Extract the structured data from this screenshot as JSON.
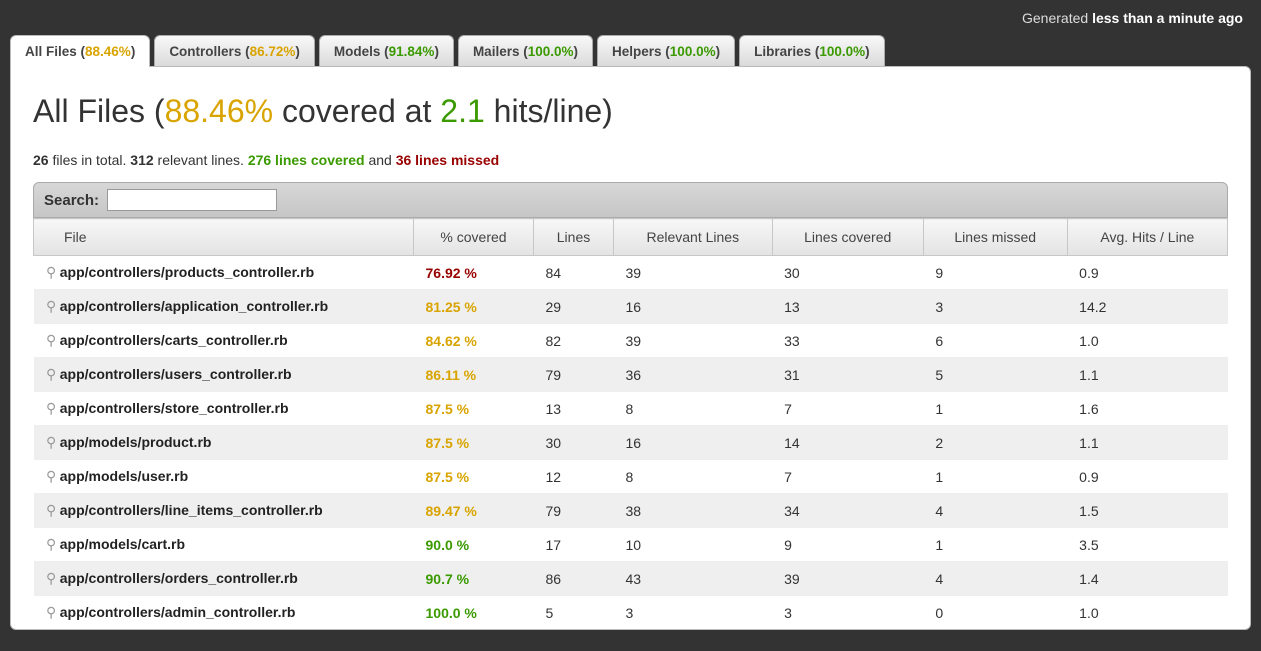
{
  "generated": {
    "prefix": "Generated",
    "time": "less than a minute ago"
  },
  "tabs": [
    {
      "label": "All Files",
      "pct": "88.46%",
      "color": "yellow",
      "active": true
    },
    {
      "label": "Controllers",
      "pct": "86.72%",
      "color": "yellow",
      "active": false
    },
    {
      "label": "Models",
      "pct": "91.84%",
      "color": "green",
      "active": false
    },
    {
      "label": "Mailers",
      "pct": "100.0%",
      "color": "green",
      "active": false
    },
    {
      "label": "Helpers",
      "pct": "100.0%",
      "color": "green",
      "active": false
    },
    {
      "label": "Libraries",
      "pct": "100.0%",
      "color": "green",
      "active": false
    }
  ],
  "title": {
    "prefix": "All Files (",
    "pct": "88.46%",
    "mid": " covered at ",
    "hits": "2.1",
    "suffix": " hits/line)"
  },
  "summary": {
    "total_files": "26",
    "files_text": " files in total. ",
    "relevant": "312",
    "relevant_text": " relevant lines. ",
    "covered": "276 lines covered",
    "and": " and ",
    "missed": "36 lines missed"
  },
  "search": {
    "label": "Search:",
    "value": ""
  },
  "columns": {
    "file": "File",
    "pct": "% covered",
    "lines": "Lines",
    "relevant": "Relevant Lines",
    "covered": "Lines covered",
    "missed": "Lines missed",
    "avg": "Avg. Hits / Line"
  },
  "rows": [
    {
      "file": "app/controllers/products_controller.rb",
      "pct": "76.92 %",
      "pctColor": "red",
      "lines": "84",
      "relevant": "39",
      "covered": "30",
      "missed": "9",
      "avg": "0.9"
    },
    {
      "file": "app/controllers/application_controller.rb",
      "pct": "81.25 %",
      "pctColor": "yellow",
      "lines": "29",
      "relevant": "16",
      "covered": "13",
      "missed": "3",
      "avg": "14.2"
    },
    {
      "file": "app/controllers/carts_controller.rb",
      "pct": "84.62 %",
      "pctColor": "yellow",
      "lines": "82",
      "relevant": "39",
      "covered": "33",
      "missed": "6",
      "avg": "1.0"
    },
    {
      "file": "app/controllers/users_controller.rb",
      "pct": "86.11 %",
      "pctColor": "yellow",
      "lines": "79",
      "relevant": "36",
      "covered": "31",
      "missed": "5",
      "avg": "1.1"
    },
    {
      "file": "app/controllers/store_controller.rb",
      "pct": "87.5 %",
      "pctColor": "yellow",
      "lines": "13",
      "relevant": "8",
      "covered": "7",
      "missed": "1",
      "avg": "1.6"
    },
    {
      "file": "app/models/product.rb",
      "pct": "87.5 %",
      "pctColor": "yellow",
      "lines": "30",
      "relevant": "16",
      "covered": "14",
      "missed": "2",
      "avg": "1.1"
    },
    {
      "file": "app/models/user.rb",
      "pct": "87.5 %",
      "pctColor": "yellow",
      "lines": "12",
      "relevant": "8",
      "covered": "7",
      "missed": "1",
      "avg": "0.9"
    },
    {
      "file": "app/controllers/line_items_controller.rb",
      "pct": "89.47 %",
      "pctColor": "yellow",
      "lines": "79",
      "relevant": "38",
      "covered": "34",
      "missed": "4",
      "avg": "1.5"
    },
    {
      "file": "app/models/cart.rb",
      "pct": "90.0 %",
      "pctColor": "green",
      "lines": "17",
      "relevant": "10",
      "covered": "9",
      "missed": "1",
      "avg": "3.5"
    },
    {
      "file": "app/controllers/orders_controller.rb",
      "pct": "90.7 %",
      "pctColor": "green",
      "lines": "86",
      "relevant": "43",
      "covered": "39",
      "missed": "4",
      "avg": "1.4"
    },
    {
      "file": "app/controllers/admin_controller.rb",
      "pct": "100.0 %",
      "pctColor": "green",
      "lines": "5",
      "relevant": "3",
      "covered": "3",
      "missed": "0",
      "avg": "1.0"
    }
  ]
}
